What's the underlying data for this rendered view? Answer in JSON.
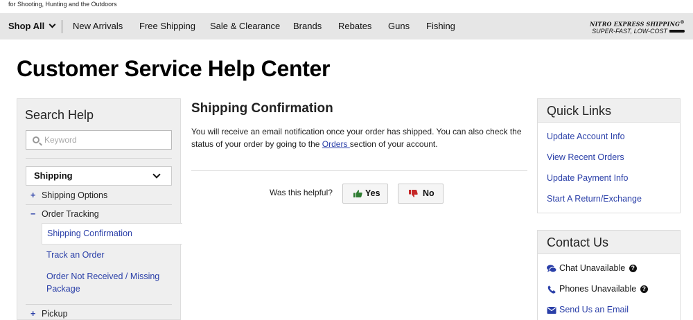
{
  "header": {
    "tagline": "for Shooting, Hunting and the Outdoors",
    "nav": {
      "shop_all": "Shop All",
      "items": [
        "New Arrivals",
        "Free Shipping",
        "Sale & Clearance",
        "Brands",
        "Rebates",
        "Guns",
        "Fishing"
      ]
    },
    "promo": {
      "title": "NITRO EXPRESS SHIPPING",
      "title_mark": "®",
      "subtitle": "SUPER-FAST, LOW-COST"
    }
  },
  "page": {
    "title": "Customer Service Help Center"
  },
  "sidebar": {
    "title": "Search Help",
    "search": {
      "placeholder": "Keyword",
      "value": ""
    },
    "category": "Shipping",
    "tree": [
      {
        "sign": "+",
        "label": "Shipping Options"
      },
      {
        "sign": "−",
        "label": "Order Tracking"
      }
    ],
    "subitems": [
      "Shipping Confirmation",
      "Track an Order",
      "Order Not Received / Missing Package"
    ],
    "active_subitem": "Shipping Confirmation",
    "next_item": {
      "sign": "+",
      "label": "Pickup"
    }
  },
  "article": {
    "title": "Shipping Confirmation",
    "text_before": "You will receive an email notification once your order has shipped.  You can also check the status of your order by going to the ",
    "link_text": "Orders ",
    "text_after": "section of your account.",
    "helpful_question": "Was this helpful?",
    "yes_label": "Yes",
    "no_label": "No"
  },
  "quick_links": {
    "title": "Quick Links",
    "items": [
      "Update Account Info",
      "View Recent Orders",
      "Update Payment Info",
      "Start A Return/Exchange"
    ]
  },
  "contact": {
    "title": "Contact Us",
    "chat": "Chat Unavailable",
    "phones": "Phones Unavailable",
    "email": "Send Us an Email",
    "help_icon_text": "?"
  },
  "colors": {
    "link": "#2a3fa8",
    "nav_bg": "#e6e6e6",
    "panel_bg": "#efefef",
    "yes_green": "#2e7d32",
    "no_red": "#c62828"
  }
}
